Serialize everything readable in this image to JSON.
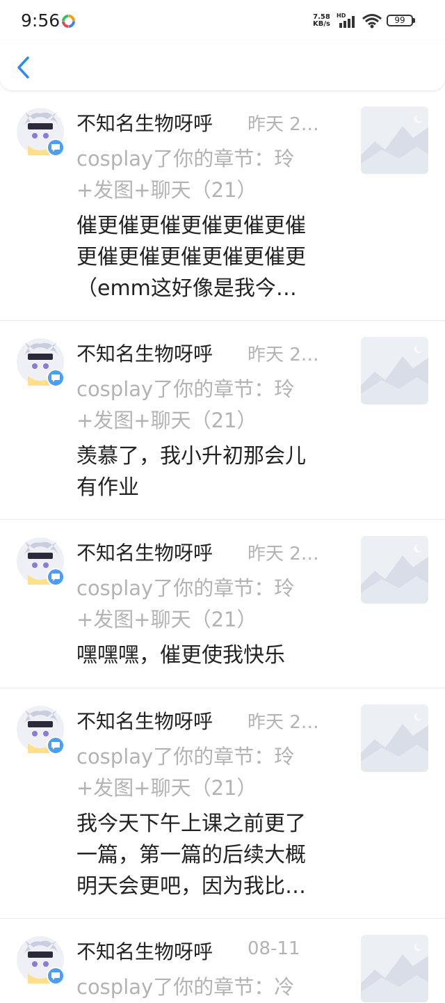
{
  "status_bar": {
    "time": "9:56",
    "net_speed_value": "7.58",
    "net_speed_unit": "KB/s",
    "hd_label": "HD",
    "battery_level": "99"
  },
  "header": {
    "back_icon": "chevron-left-icon"
  },
  "notifications": [
    {
      "user": "不知名生物呀呼",
      "time": "昨天 2…",
      "action_line1": "cosplay了你的章节：玲",
      "action_line2": "+发图+聊天（21）",
      "comment_lines": [
        "催更催更催更催更催更催",
        "更催更催更催更催更催更",
        "（emm这好像是我今…"
      ]
    },
    {
      "user": "不知名生物呀呼",
      "time": "昨天 2…",
      "action_line1": "cosplay了你的章节：玲",
      "action_line2": "+发图+聊天（21）",
      "comment_lines": [
        "羡慕了，我小升初那会儿",
        "有作业"
      ]
    },
    {
      "user": "不知名生物呀呼",
      "time": "昨天 2…",
      "action_line1": "cosplay了你的章节：玲",
      "action_line2": "+发图+聊天（21）",
      "comment_lines": [
        "嘿嘿嘿，催更使我快乐"
      ]
    },
    {
      "user": "不知名生物呀呼",
      "time": "昨天 2…",
      "action_line1": "cosplay了你的章节：玲",
      "action_line2": "+发图+聊天（21）",
      "comment_lines": [
        "我今天下午上课之前更了",
        "一篇，第一篇的后续大概",
        "明天会更吧，因为我比…"
      ]
    },
    {
      "user": "不知名生物呀呼",
      "time": "08-11",
      "action_line1": "cosplay了你的章节：冷",
      "action_line2": "",
      "comment_lines": []
    }
  ]
}
